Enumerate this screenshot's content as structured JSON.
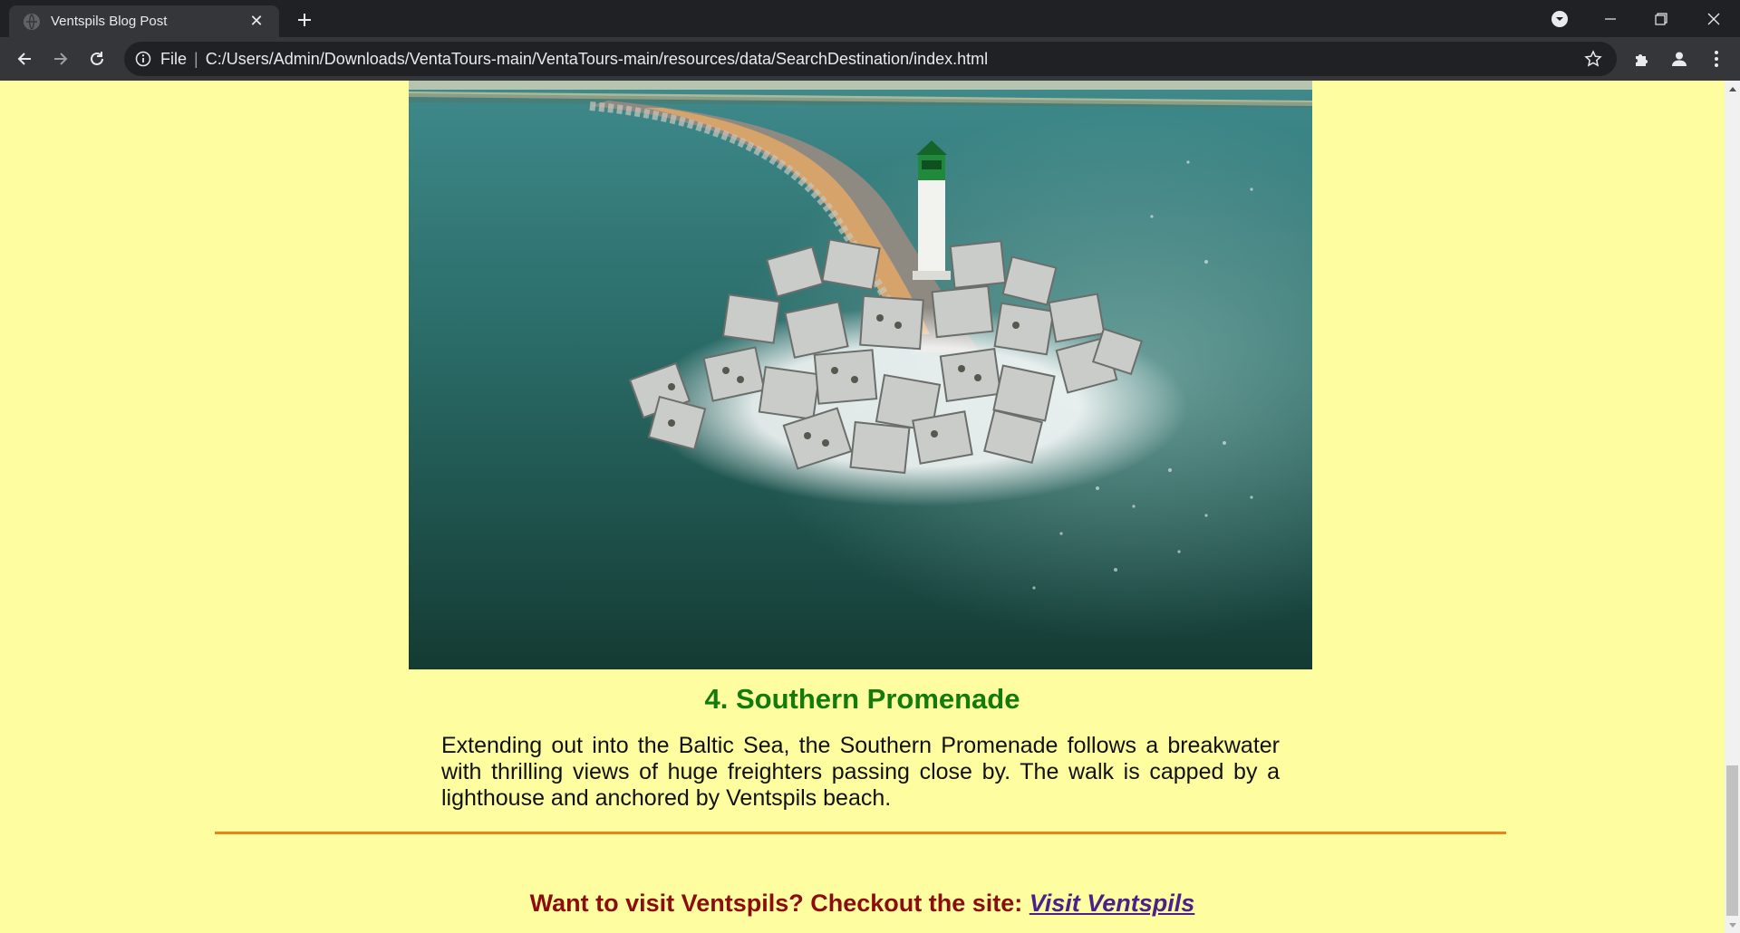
{
  "browser": {
    "tab_title": "Ventspils Blog Post",
    "tab_close": "✕",
    "new_tab": "+",
    "omnibox_scheme": "File",
    "omnibox_separator": "|",
    "omnibox_url": "C:/Users/Admin/Downloads/VentaTours-main/VentaTours-main/resources/data/SearchDestination/index.html",
    "theme_dark": "#202124",
    "theme_toolbar": "#35363a"
  },
  "page": {
    "background": "#fefea1",
    "section": {
      "title": "4. Southern Promenade",
      "text": "Extending out into the Baltic Sea, the Southern Promenade follows a breakwater with thrilling views of huge freighters passing close by. The walk is capped by a lighthouse and anchored by Ventspils beach.",
      "title_color": "#137a0c"
    },
    "divider_color": "#e4861c",
    "cta": {
      "prefix": "Want to visit Ventspils? Checkout the site: ",
      "link_text": "Visit Ventspils",
      "prefix_color": "#8b0d0d",
      "link_color": "#4b1f8c"
    }
  },
  "icons": {
    "favicon": "globe-icon",
    "back": "arrow-left-icon",
    "forward": "arrow-right-icon",
    "reload": "reload-icon",
    "info": "info-icon",
    "bookmark": "star-icon",
    "extensions": "puzzle-icon",
    "profile": "person-icon",
    "menu": "kebab-menu-icon"
  }
}
